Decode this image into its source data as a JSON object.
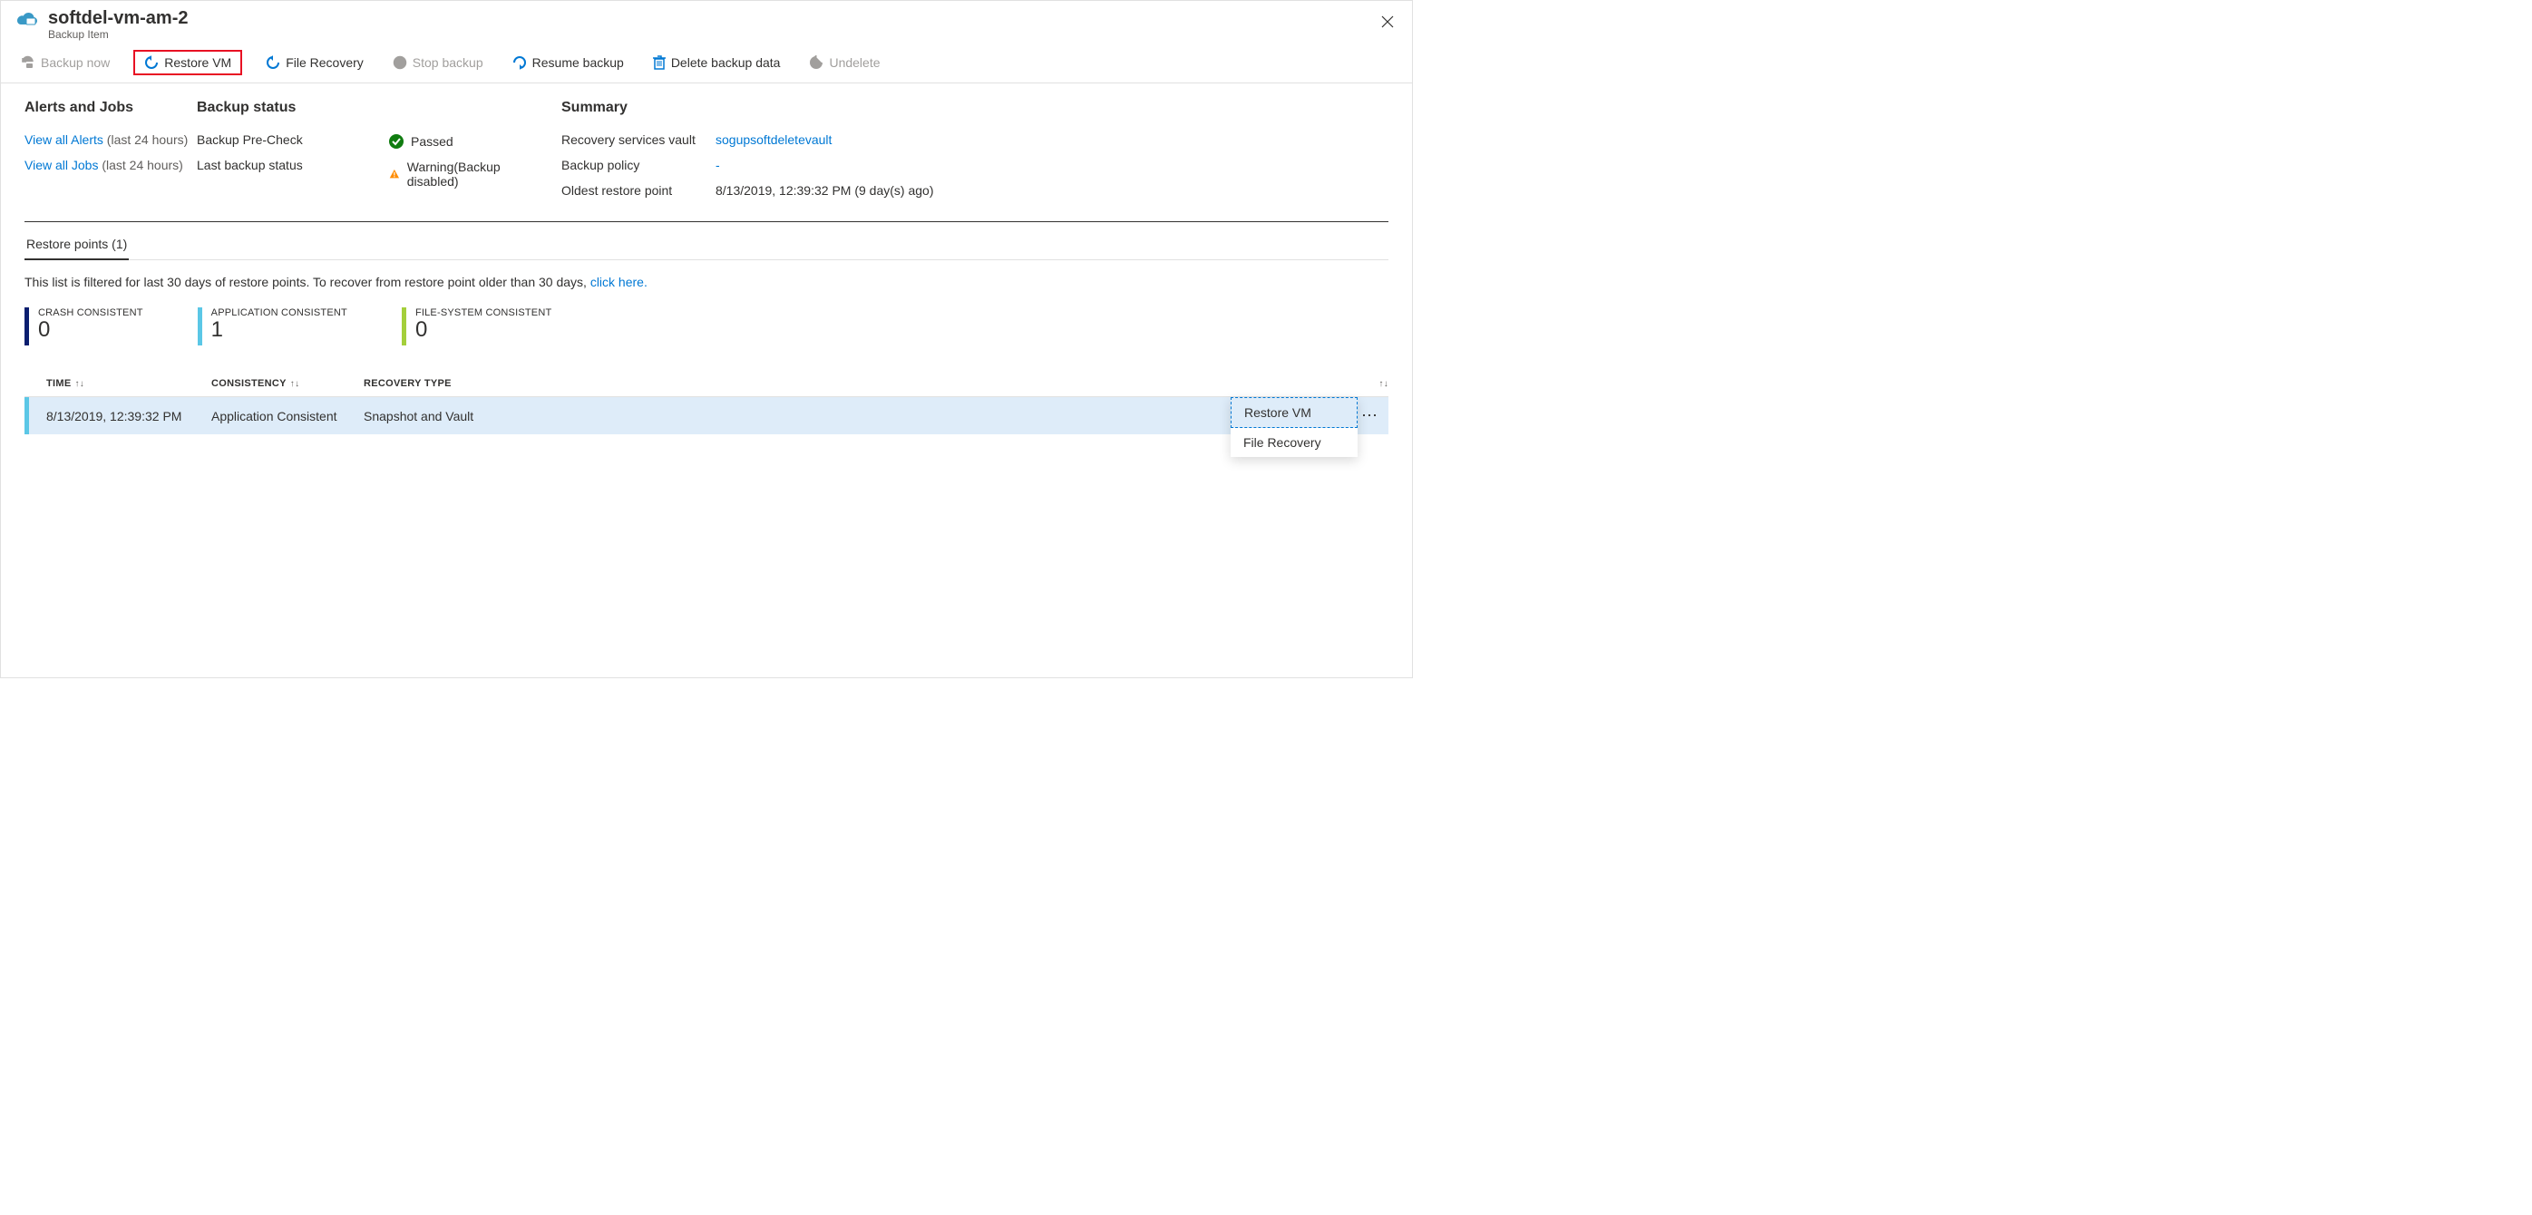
{
  "header": {
    "title": "softdel-vm-am-2",
    "subtitle": "Backup Item"
  },
  "toolbar": {
    "backup_now": "Backup now",
    "restore_vm": "Restore VM",
    "file_recovery": "File Recovery",
    "stop_backup": "Stop backup",
    "resume_backup": "Resume backup",
    "delete_backup_data": "Delete backup data",
    "undelete": "Undelete"
  },
  "sections": {
    "alerts": {
      "title": "Alerts and Jobs",
      "view_alerts": "View all Alerts",
      "view_jobs": "View all Jobs",
      "last24": "(last 24 hours)"
    },
    "backup_status": {
      "title": "Backup status",
      "precheck_label": "Backup Pre-Check",
      "precheck_value": "Passed",
      "last_backup_label": "Last backup status",
      "last_backup_value": "Warning(Backup disabled)"
    },
    "summary": {
      "title": "Summary",
      "vault_label": "Recovery services vault",
      "vault_value": "sogupsoftdeletevault",
      "policy_label": "Backup policy",
      "policy_value": "-",
      "oldest_label": "Oldest restore point",
      "oldest_value": "8/13/2019, 12:39:32 PM (9 day(s) ago)"
    }
  },
  "tabs": {
    "restore_points": "Restore points (1)"
  },
  "filter": {
    "text_prefix": "This list is filtered for last 30 days of restore points. To recover from restore point older than 30 days, ",
    "link": "click here."
  },
  "consistency": {
    "crash": {
      "label": "CRASH CONSISTENT",
      "value": "0"
    },
    "app": {
      "label": "APPLICATION CONSISTENT",
      "value": "1"
    },
    "fs": {
      "label": "FILE-SYSTEM CONSISTENT",
      "value": "0"
    }
  },
  "table": {
    "headers": {
      "time": "TIME",
      "consistency": "CONSISTENCY",
      "recovery_type": "RECOVERY TYPE"
    },
    "row": {
      "time": "8/13/2019, 12:39:32 PM",
      "consistency": "Application Consistent",
      "recovery_type": "Snapshot and Vault"
    }
  },
  "context_menu": {
    "restore_vm": "Restore VM",
    "file_recovery": "File Recovery"
  }
}
